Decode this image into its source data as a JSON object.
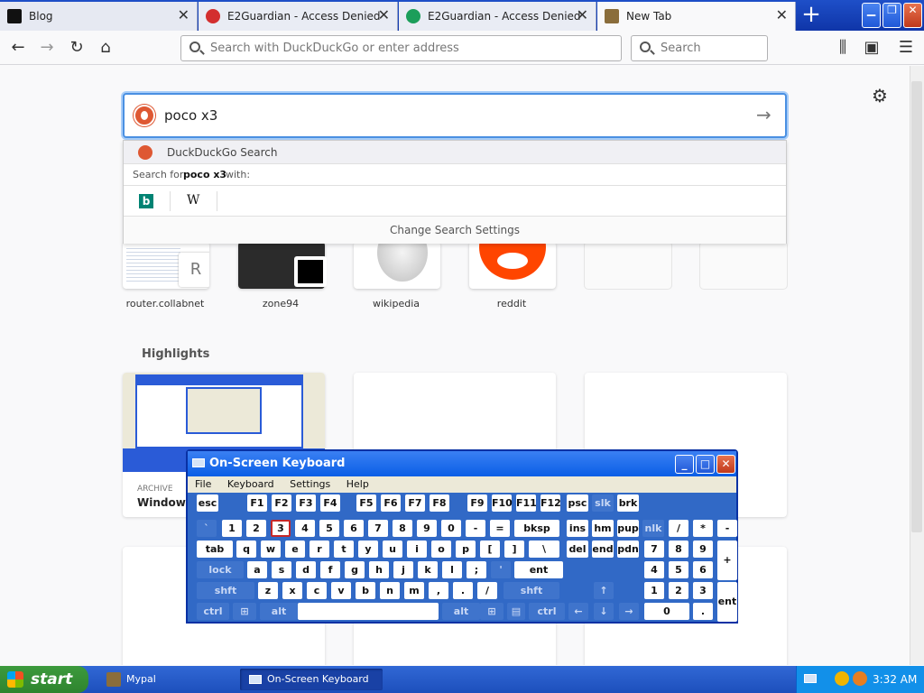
{
  "tabs": [
    {
      "title": "Blog",
      "icon": "blog-favicon-icon"
    },
    {
      "title": "E2Guardian - Access Denied",
      "icon": "e2guardian-red-icon"
    },
    {
      "title": "E2Guardian - Access Denied",
      "icon": "e2guardian-green-icon"
    },
    {
      "title": "New Tab",
      "icon": "new-tab-icon"
    }
  ],
  "nav": {
    "url_placeholder": "Search with DuckDuckGo or enter address",
    "search_placeholder": "Search"
  },
  "search": {
    "query": "poco x3",
    "engine_label": "DuckDuckGo Search",
    "search_for_prefix": "Search for",
    "search_for_query": "poco x3",
    "search_for_suffix": "with:",
    "alt_engines": [
      "b",
      "W"
    ],
    "change_settings": "Change Search Settings"
  },
  "topsites": [
    {
      "label": "router.collabnet",
      "letter": "R"
    },
    {
      "label": "zone94"
    },
    {
      "label": "wikipedia"
    },
    {
      "label": "reddit"
    }
  ],
  "highlights": {
    "heading": "Highlights",
    "card": {
      "badge": "ARCHIVE",
      "title": "Windows"
    }
  },
  "osk": {
    "title": "On-Screen Keyboard",
    "menu": [
      "File",
      "Keyboard",
      "Settings",
      "Help"
    ],
    "pressed_key": "3"
  },
  "taskbar": {
    "start": "start",
    "items": [
      "Mypal",
      "On-Screen Keyboard"
    ],
    "time": "3:32 AM"
  },
  "colors": {
    "accent": "#4a90e2",
    "ddg": "#de5833",
    "xp_blue": "#3169c6"
  }
}
